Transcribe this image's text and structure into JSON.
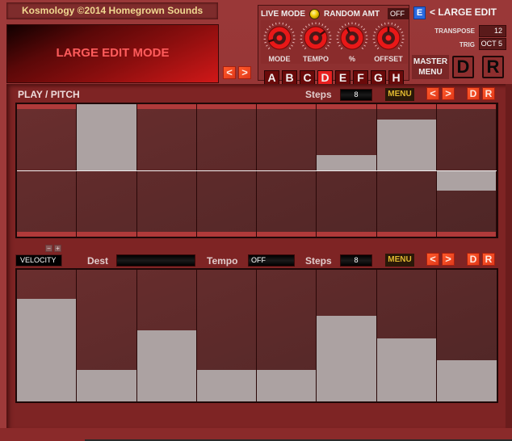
{
  "header": {
    "brand": "Kosmology ©2014 Homegrown Sounds",
    "mode_display": "LARGE EDIT MODE",
    "prev_label": "<",
    "next_label": ">"
  },
  "live_panel": {
    "live_mode_label": "LIVE MODE",
    "live_mode_on": true,
    "random_amt_label": "RANDOM AMT",
    "random_amt_value": "OFF",
    "knobs": [
      {
        "label": "MODE",
        "value": 0.1
      },
      {
        "label": "TEMPO",
        "value": 0.7
      },
      {
        "label": "%",
        "value": 0.4
      },
      {
        "label": "OFFSET",
        "value": 0.5
      }
    ],
    "patterns": [
      "A",
      "B",
      "C",
      "D",
      "E",
      "F",
      "G",
      "H"
    ],
    "active_pattern": "D"
  },
  "right_panel": {
    "e_badge": "E",
    "large_edit_link": "< LARGE EDIT",
    "transpose_label": "TRANSPOSE",
    "transpose_value": "12",
    "trig_label": "TRIG",
    "trig_value": "OCT 5",
    "master_menu_line1": "MASTER",
    "master_menu_line2": "MENU",
    "big_d": "D",
    "big_r": "R"
  },
  "pitch_section": {
    "title": "PLAY / PITCH",
    "steps_label": "Steps",
    "steps_value": "8",
    "menu_label": "MENU",
    "prev_label": "<",
    "next_label": ">",
    "d_label": "D",
    "r_label": "R",
    "values": [
      0,
      1.0,
      0,
      0,
      0,
      0.23,
      0.77,
      -0.31
    ]
  },
  "velocity_section": {
    "target": "VELOCITY",
    "minus_label": "−",
    "plus_label": "+",
    "dest_label": "Dest",
    "dest_value": "",
    "tempo_label": "Tempo",
    "tempo_value": "OFF",
    "steps_label": "Steps",
    "steps_value": "8",
    "menu_label": "MENU",
    "prev_label": "<",
    "next_label": ">",
    "d_label": "D",
    "r_label": "R",
    "values": [
      0.78,
      0.24,
      0.54,
      0.24,
      0.24,
      0.65,
      0.48,
      0.31
    ]
  }
}
